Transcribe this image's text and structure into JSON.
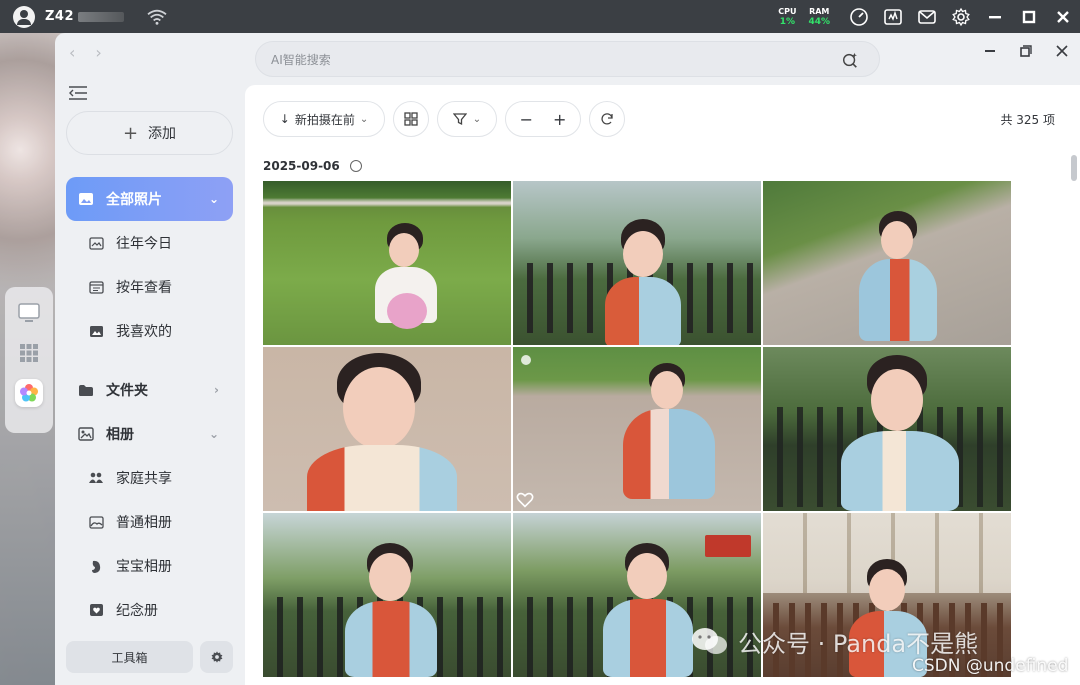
{
  "system_bar": {
    "device_name": "Z42",
    "cpu_label": "CPU",
    "cpu_value": "1%",
    "ram_label": "RAM",
    "ram_value": "44%",
    "accent_green": "#32e26a"
  },
  "dock": {
    "items": [
      "monitor-icon",
      "app-grid-icon",
      "photos-app-icon"
    ]
  },
  "search": {
    "placeholder": "AI智能搜索"
  },
  "sidebar": {
    "add_label": "添加",
    "items": [
      {
        "label": "全部照片",
        "icon": "photos-icon",
        "active": true
      },
      {
        "label": "往年今日",
        "icon": "image-frame-icon"
      },
      {
        "label": "按年查看",
        "icon": "calendar-icon"
      },
      {
        "label": "我喜欢的",
        "icon": "image-icon"
      },
      {
        "label": "文件夹",
        "icon": "folder-icon"
      },
      {
        "label": "相册",
        "icon": "album-icon"
      },
      {
        "label": "家庭共享",
        "icon": "family-icon"
      },
      {
        "label": "普通相册",
        "icon": "gallery-icon"
      },
      {
        "label": "宝宝相册",
        "icon": "baby-icon"
      },
      {
        "label": "纪念册",
        "icon": "heart-book-icon"
      }
    ],
    "toolbox_label": "工具箱",
    "active_color": "#6d9bf7"
  },
  "toolbar": {
    "sort_label": "新拍摄在前",
    "total_label": "共 325 项"
  },
  "timeline": {
    "date": "2025-09-06"
  },
  "photos": [
    {
      "scene": "grass-balloon"
    },
    {
      "scene": "bench-park"
    },
    {
      "scene": "path-running"
    },
    {
      "scene": "closeup-tiles"
    },
    {
      "scene": "walking-tiles",
      "favorite": true
    },
    {
      "scene": "bench-leaves"
    },
    {
      "scene": "bench-laugh"
    },
    {
      "scene": "bench-sign"
    },
    {
      "scene": "gazebo-boards"
    }
  ],
  "watermark": {
    "wechat_text": "公众号 · Panda不是熊",
    "csdn_text": "CSDN @undefined"
  }
}
